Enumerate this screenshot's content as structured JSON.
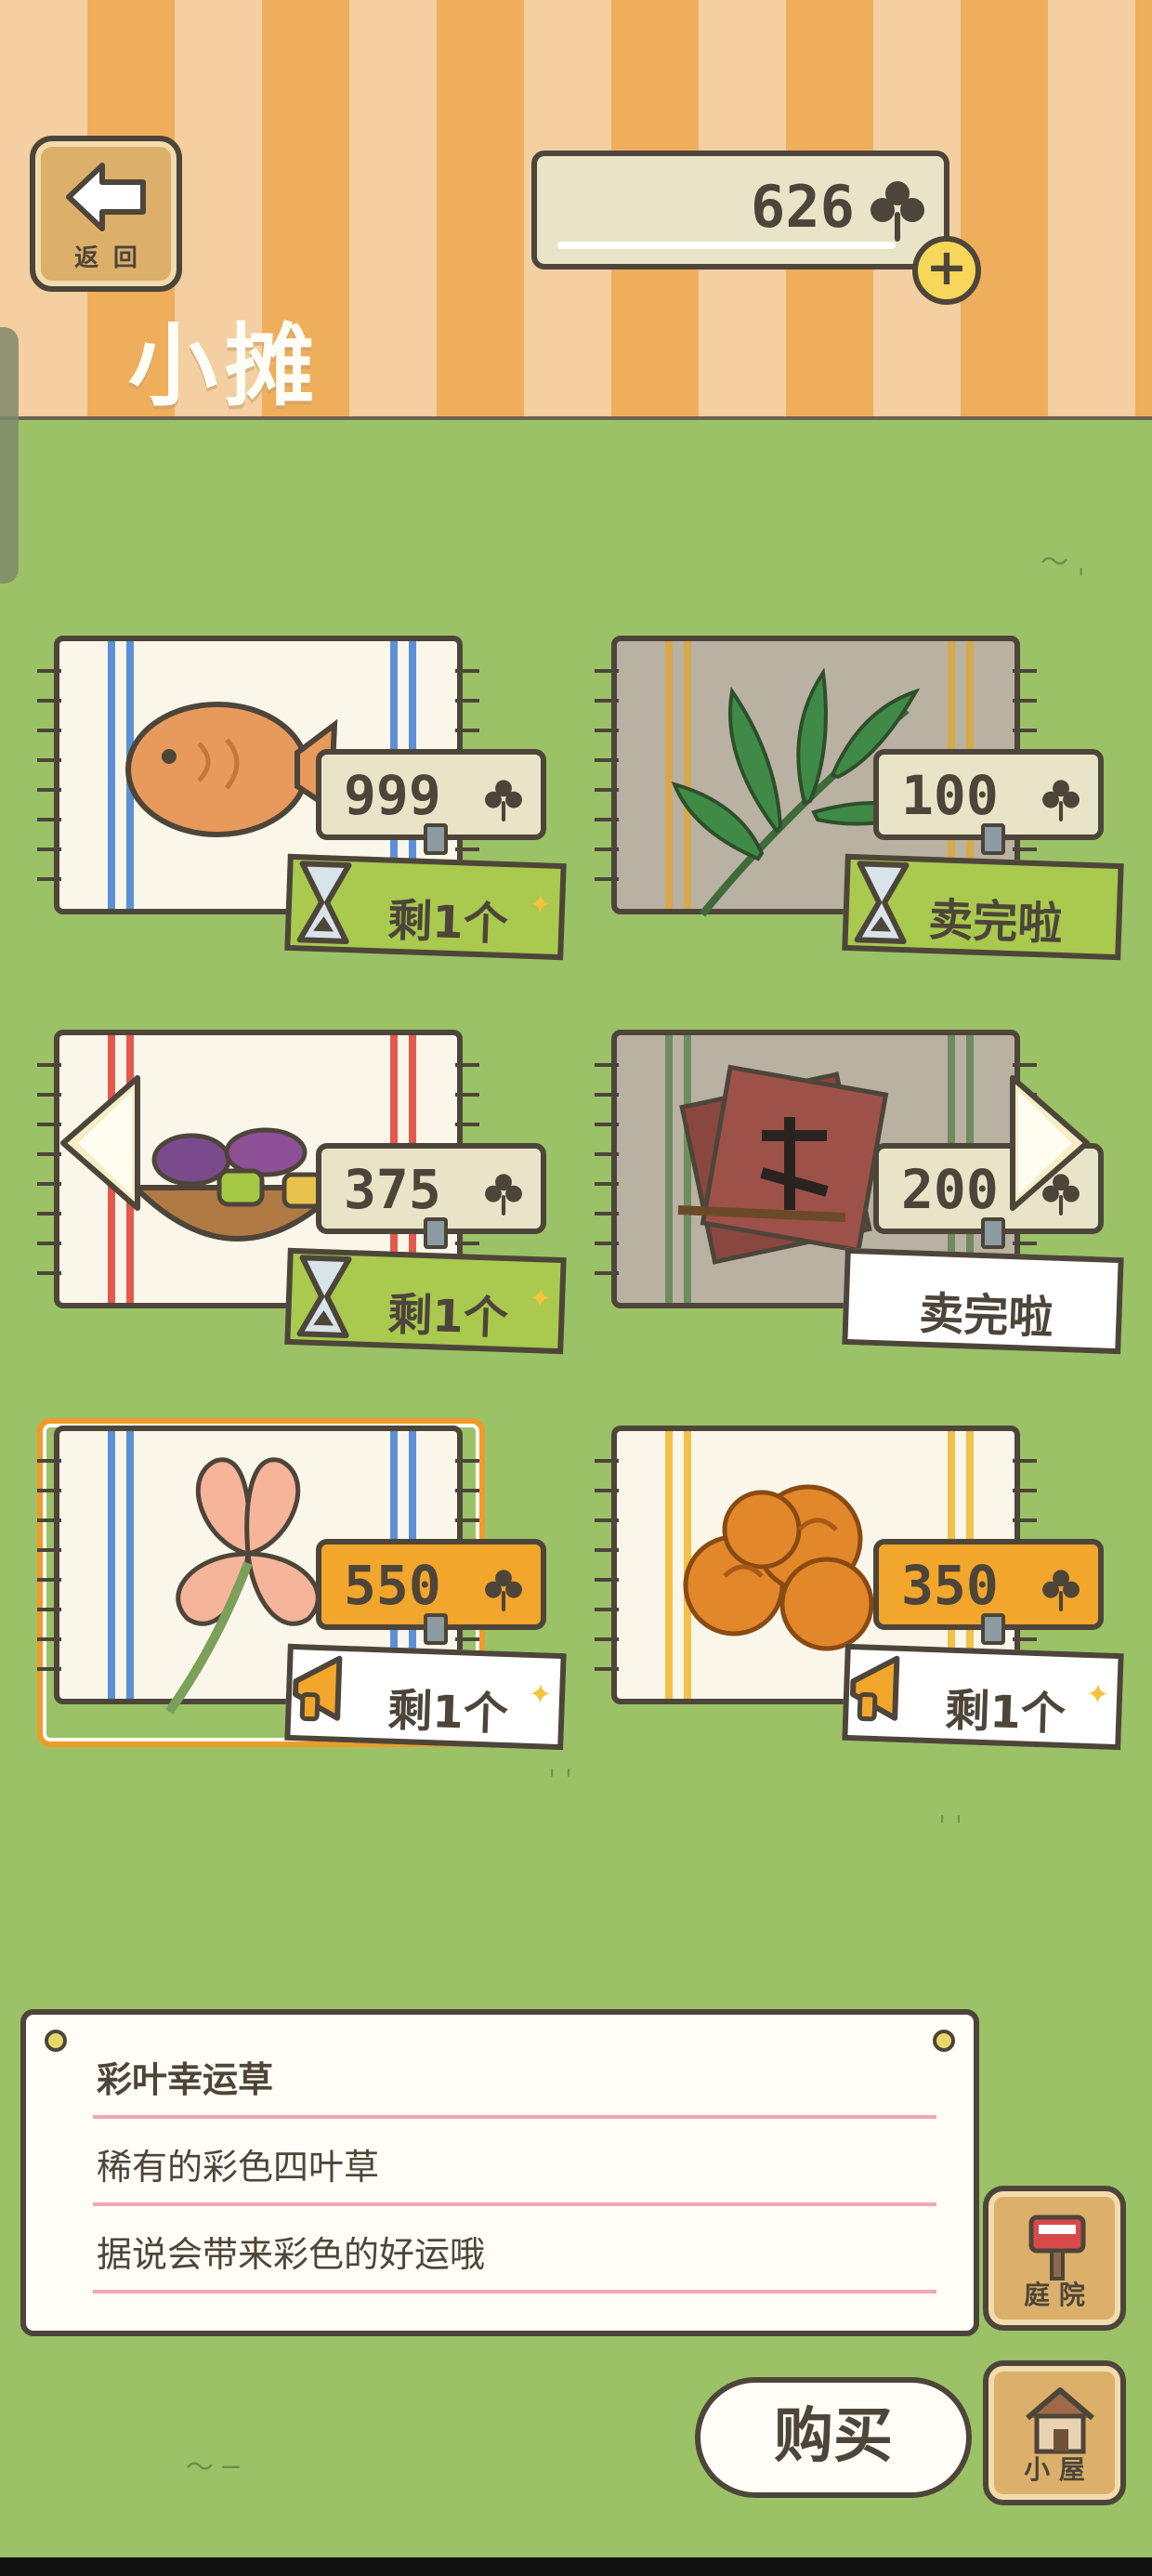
{
  "header": {
    "back_label": "返 回",
    "title": "小摊",
    "balance": "626",
    "add_symbol": "+"
  },
  "items": [
    {
      "price": "999",
      "status": "剩1个",
      "status_style": "remaining"
    },
    {
      "price": "100",
      "status": "卖完啦",
      "status_style": "soldout-green"
    },
    {
      "price": "375",
      "status": "剩1个",
      "status_style": "remaining"
    },
    {
      "price": "200",
      "status": "卖完啦",
      "status_style": "soldout-white"
    },
    {
      "price": "550",
      "status": "剩1个",
      "status_style": "promo"
    },
    {
      "price": "350",
      "status": "剩1个",
      "status_style": "promo"
    }
  ],
  "description": {
    "name": "彩叶幸运草",
    "line1": "稀有的彩色四叶草",
    "line2": "据说会带来彩色的好运哦"
  },
  "buttons": {
    "yard_label": "庭 院",
    "house_label": "小 屋",
    "buy_label": "购买"
  },
  "colors": {
    "grass": "#9bc266",
    "tag_cream": "#e8e4c8",
    "tag_orange": "#f2a62c",
    "status_green": "#a9c94f",
    "outline": "#4d4539",
    "selected_frame": "#f09a2a"
  },
  "icons": [
    "back-arrow-icon",
    "clover-icon",
    "plus-icon",
    "hourglass-icon",
    "megaphone-icon",
    "chevron-left-icon",
    "chevron-right-icon",
    "yard-mailbox-icon",
    "house-icon"
  ]
}
